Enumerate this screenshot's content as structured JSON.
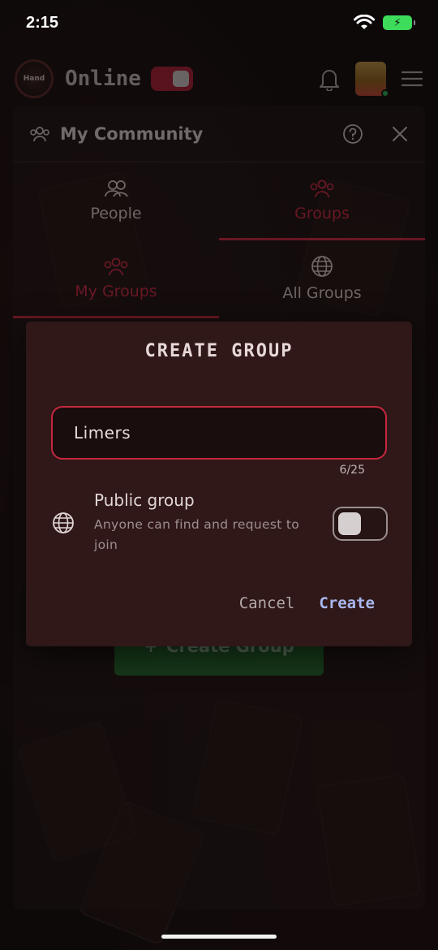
{
  "status_bar": {
    "time": "2:15"
  },
  "app_bar": {
    "logo_text": "Hand",
    "online_label": "Online"
  },
  "community": {
    "title": "My Community",
    "tabs": [
      {
        "label": "People"
      },
      {
        "label": "Groups"
      }
    ],
    "subtabs": [
      {
        "label": "My Groups"
      },
      {
        "label": "All Groups"
      }
    ],
    "create_group_button": "Create Group"
  },
  "dialog": {
    "title": "CREATE GROUP",
    "name_value": "Limers",
    "counter": "6/25",
    "public_title": "Public group",
    "public_desc": "Anyone can find and request to join",
    "cancel_label": "Cancel",
    "create_label": "Create"
  },
  "colors": {
    "accent_red": "#c4283e",
    "create_link": "#a9b8f0",
    "battery_green": "#3ddc5a"
  }
}
